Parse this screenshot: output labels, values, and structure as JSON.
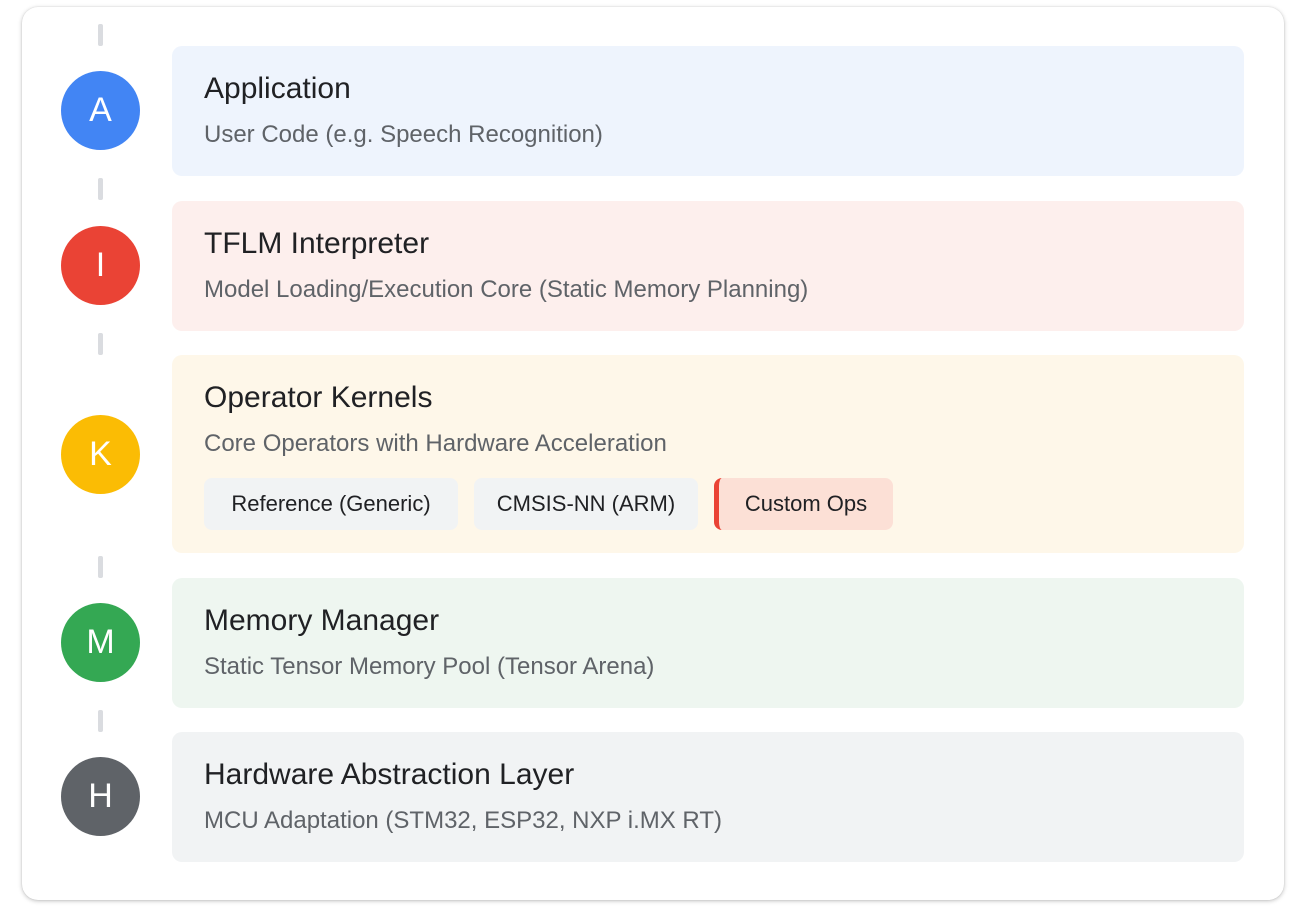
{
  "colors": {
    "application": "#4285f4",
    "interpreter": "#ea4335",
    "kernels": "#fbbc04",
    "memory": "#34a853",
    "hal": "#5f6368"
  },
  "layers": [
    {
      "badge": "A",
      "title": "Application",
      "subtitle": "User Code (e.g. Speech Recognition)"
    },
    {
      "badge": "I",
      "title": "TFLM Interpreter",
      "subtitle": "Model Loading/Execution Core (Static Memory Planning)"
    },
    {
      "badge": "K",
      "title": "Operator Kernels",
      "subtitle": "Core Operators with Hardware Acceleration",
      "chips": [
        "Reference (Generic)",
        "CMSIS-NN (ARM)",
        "Custom Ops"
      ]
    },
    {
      "badge": "M",
      "title": "Memory Manager",
      "subtitle": "Static Tensor Memory Pool (Tensor Arena)"
    },
    {
      "badge": "H",
      "title": "Hardware Abstraction Layer",
      "subtitle": "MCU Adaptation (STM32, ESP32, NXP i.MX RT)"
    }
  ]
}
